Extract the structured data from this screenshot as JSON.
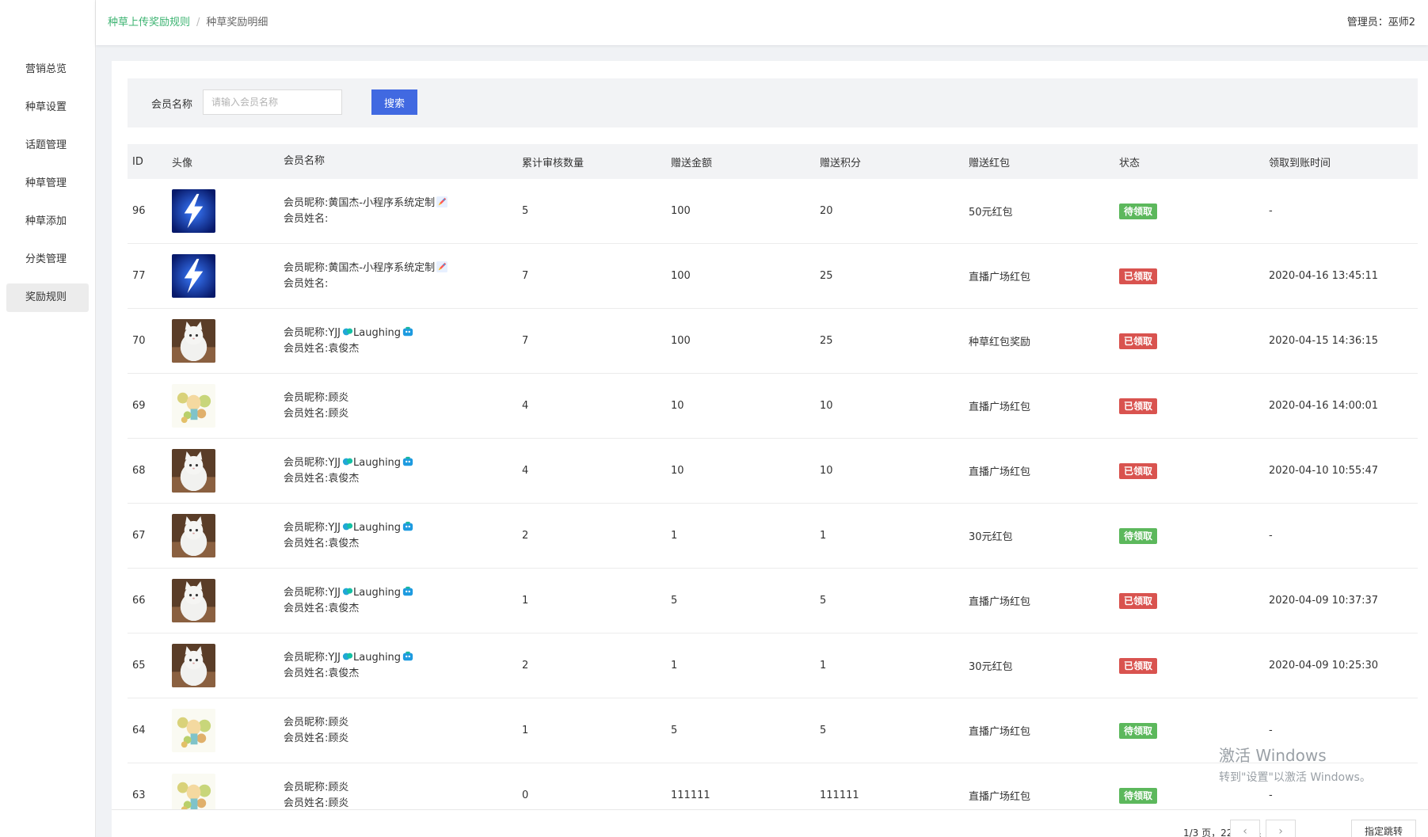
{
  "sidebar": {
    "items": [
      {
        "label": "营销总览",
        "active": false
      },
      {
        "label": "种草设置",
        "active": false
      },
      {
        "label": "话题管理",
        "active": false
      },
      {
        "label": "种草管理",
        "active": false
      },
      {
        "label": "种草添加",
        "active": false
      },
      {
        "label": "分类管理",
        "active": false
      },
      {
        "label": "奖励规则",
        "active": true
      }
    ]
  },
  "header": {
    "breadcrumb_link": "种草上传奖励规则",
    "breadcrumb_sep": "/",
    "breadcrumb_current": "种草奖励明细",
    "admin": "管理员：巫师2"
  },
  "search": {
    "label": "会员名称",
    "placeholder": "请输入会员名称",
    "value": "",
    "button": "搜索"
  },
  "table": {
    "columns": [
      "ID",
      "头像",
      "会员名称",
      "累计审核数量",
      "赠送金额",
      "赠送积分",
      "赠送红包",
      "状态",
      "领取到账时间"
    ],
    "rows": [
      {
        "id": "96",
        "avatar": "lightning",
        "nickname": "会员昵称:黄国杰-小程序系统定制",
        "nick_emoji": "rocket",
        "realname": "会员姓名:",
        "count": "5",
        "amount": "100",
        "points": "20",
        "redpack": "50元红包",
        "status": "待领取",
        "status_color": "#5cb85c",
        "time": "-"
      },
      {
        "id": "77",
        "avatar": "lightning",
        "nickname": "会员昵称:黄国杰-小程序系统定制",
        "nick_emoji": "rocket",
        "realname": "会员姓名:",
        "count": "7",
        "amount": "100",
        "points": "25",
        "redpack": "直播广场红包",
        "status": "已领取",
        "status_color": "#d9534f",
        "time": "2020-04-16 13:45:11"
      },
      {
        "id": "70",
        "avatar": "cat",
        "nickname": "会员昵称:YJJ",
        "nick_suffix": "Laughing",
        "nick_emoji": "blue",
        "realname": "会员姓名:袁俊杰",
        "count": "7",
        "amount": "100",
        "points": "25",
        "redpack": "种草红包奖励",
        "status": "已领取",
        "status_color": "#d9534f",
        "time": "2020-04-15 14:36:15"
      },
      {
        "id": "69",
        "avatar": "anime",
        "nickname": "会员昵称:顾炎",
        "realname": "会员姓名:顾炎",
        "count": "4",
        "amount": "10",
        "points": "10",
        "redpack": "直播广场红包",
        "status": "已领取",
        "status_color": "#d9534f",
        "time": "2020-04-16 14:00:01"
      },
      {
        "id": "68",
        "avatar": "cat",
        "nickname": "会员昵称:YJJ",
        "nick_suffix": "Laughing",
        "nick_emoji": "blue",
        "realname": "会员姓名:袁俊杰",
        "count": "4",
        "amount": "10",
        "points": "10",
        "redpack": "直播广场红包",
        "status": "已领取",
        "status_color": "#d9534f",
        "time": "2020-04-10 10:55:47"
      },
      {
        "id": "67",
        "avatar": "cat",
        "nickname": "会员昵称:YJJ",
        "nick_suffix": "Laughing",
        "nick_emoji": "blue",
        "realname": "会员姓名:袁俊杰",
        "count": "2",
        "amount": "1",
        "points": "1",
        "redpack": "30元红包",
        "status": "待领取",
        "status_color": "#5cb85c",
        "time": "-"
      },
      {
        "id": "66",
        "avatar": "cat",
        "nickname": "会员昵称:YJJ",
        "nick_suffix": "Laughing",
        "nick_emoji": "blue",
        "realname": "会员姓名:袁俊杰",
        "count": "1",
        "amount": "5",
        "points": "5",
        "redpack": "直播广场红包",
        "status": "已领取",
        "status_color": "#d9534f",
        "time": "2020-04-09 10:37:37"
      },
      {
        "id": "65",
        "avatar": "cat",
        "nickname": "会员昵称:YJJ",
        "nick_suffix": "Laughing",
        "nick_emoji": "blue",
        "realname": "会员姓名:袁俊杰",
        "count": "2",
        "amount": "1",
        "points": "1",
        "redpack": "30元红包",
        "status": "已领取",
        "status_color": "#d9534f",
        "time": "2020-04-09 10:25:30"
      },
      {
        "id": "64",
        "avatar": "anime",
        "nickname": "会员昵称:顾炎",
        "realname": "会员姓名:顾炎",
        "count": "1",
        "amount": "5",
        "points": "5",
        "redpack": "直播广场红包",
        "status": "待领取",
        "status_color": "#5cb85c",
        "time": "-"
      },
      {
        "id": "63",
        "avatar": "anime",
        "nickname": "会员昵称:顾炎",
        "realname": "会员姓名:顾炎",
        "count": "0",
        "amount": "111111",
        "points": "111111",
        "redpack": "直播广场红包",
        "status": "待领取",
        "status_color": "#5cb85c",
        "time": "-"
      }
    ]
  },
  "pagination": {
    "info": "1/3 页，22条结果",
    "prev": "‹",
    "next": "›",
    "jump": "指定跳转"
  },
  "watermark": {
    "line1": "激活 Windows",
    "line2": "转到\"设置\"以激活 Windows。"
  }
}
